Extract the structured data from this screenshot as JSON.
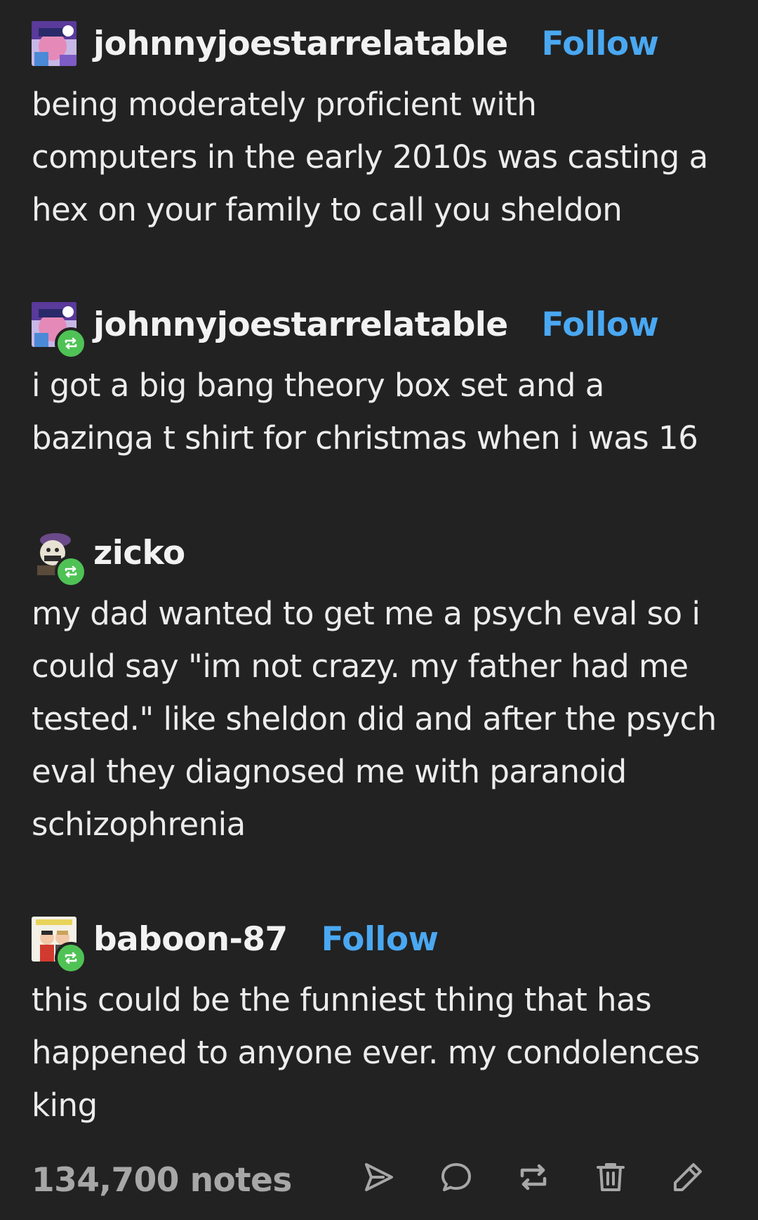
{
  "posts": [
    {
      "username": "johnnyjoestarrelatable",
      "follow_label": "Follow",
      "body": "being moderately proficient with\ncomputers in the early 2010s was casting a\nhex on your family to call you sheldon"
    },
    {
      "username": "johnnyjoestarrelatable",
      "follow_label": "Follow",
      "body": "i got a big bang theory box set and a\nbazinga t shirt for christmas when i was 16"
    },
    {
      "username": "zicko",
      "body": "my dad wanted to get me a psych eval so i\ncould say \"im not crazy. my father had me\ntested.\" like sheldon did and after the psych\neval they diagnosed me with paranoid\nschizophrenia"
    },
    {
      "username": "baboon-87",
      "follow_label": "Follow",
      "body": "this could be the funniest thing that has\nhappened to anyone ever. my condolences\nking"
    }
  ],
  "footer": {
    "notes": "134,700 notes",
    "icons": [
      "share-icon",
      "reply-icon",
      "reblog-icon",
      "delete-icon",
      "edit-icon"
    ]
  },
  "colors": {
    "background": "#222222",
    "text": "#ececec",
    "follow": "#4aa8f2",
    "reblog_badge": "#4fc255",
    "muted": "#a7a7a7"
  }
}
